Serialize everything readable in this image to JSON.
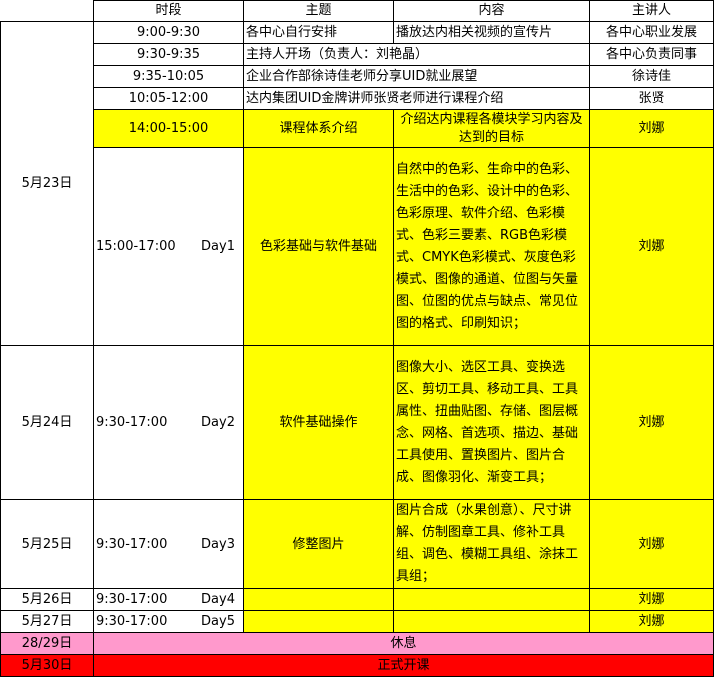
{
  "headers": {
    "time": "时段",
    "topic": "主题",
    "content": "内容",
    "speaker": "主讲人"
  },
  "rows": {
    "r1": {
      "time": "9:00-9:30",
      "topic": "各中心自行安排",
      "content": "播放达内相关视频的宣传片",
      "speaker": "各中心职业发展"
    },
    "r2": {
      "time": "9:30-9:35",
      "topic": "主持人开场（负责人：刘艳晶）",
      "speaker": "各中心负责同事"
    },
    "r3": {
      "time": "9:35-10:05",
      "topic": "企业合作部徐诗佳老师分享UID就业展望",
      "speaker": "徐诗佳"
    },
    "r4": {
      "time": "10:05-12:00",
      "topic": "达内集团UID金牌讲师张贤老师进行课程介绍",
      "speaker": "张贤"
    },
    "r5": {
      "time": "14:00-15:00",
      "topic": "课程体系介绍",
      "content": "介绍达内课程各模块学习内容及达到的目标",
      "speaker": "刘娜"
    },
    "r6": {
      "time": "15:00-17:00",
      "day": "Day1",
      "topic": "色彩基础与软件基础",
      "content": "自然中的色彩、生命中的色彩、生活中的色彩、设计中的色彩、色彩原理、软件介绍、色彩模式、色彩三要素、RGB色彩模式、CMYK色彩模式、灰度色彩模式、图像的通道、位图与矢量图、位图的优点与缺点、常见位图的格式、印刷知识；",
      "speaker": "刘娜"
    },
    "r7": {
      "date": "5月24日",
      "time": "9:30-17:00",
      "day": "Day2",
      "topic": "软件基础操作",
      "content": "图像大小、选区工具、变换选区、剪切工具、移动工具、工具属性、扭曲贴图、存储、图层概念、网格、首选项、描边、基础工具使用、置换图片、图片合成、图像羽化、渐变工具；",
      "speaker": "刘娜"
    },
    "r8": {
      "date": "5月25日",
      "time": "9:30-17:00",
      "day": "Day3",
      "topic": "修整图片",
      "content": "图片合成（水果创意）、尺寸讲解、仿制图章工具、修补工具组、调色、模糊工具组、涂抹工具组；",
      "speaker": "刘娜"
    },
    "r9": {
      "date": "5月26日",
      "time": "9:30-17:00",
      "day": "Day4",
      "speaker": "刘娜"
    },
    "r10": {
      "date": "5月27日",
      "time": "9:30-17:00",
      "day": "Day5",
      "speaker": "刘娜"
    },
    "r11": {
      "date": "28/29日",
      "note": "休息"
    },
    "r12": {
      "date": "5月30日",
      "note": "正式开课"
    }
  },
  "day1_date": "5月23日",
  "colors": {
    "highlight": "#ffff00",
    "rest": "#ff99cc",
    "start": "#ff0000"
  }
}
